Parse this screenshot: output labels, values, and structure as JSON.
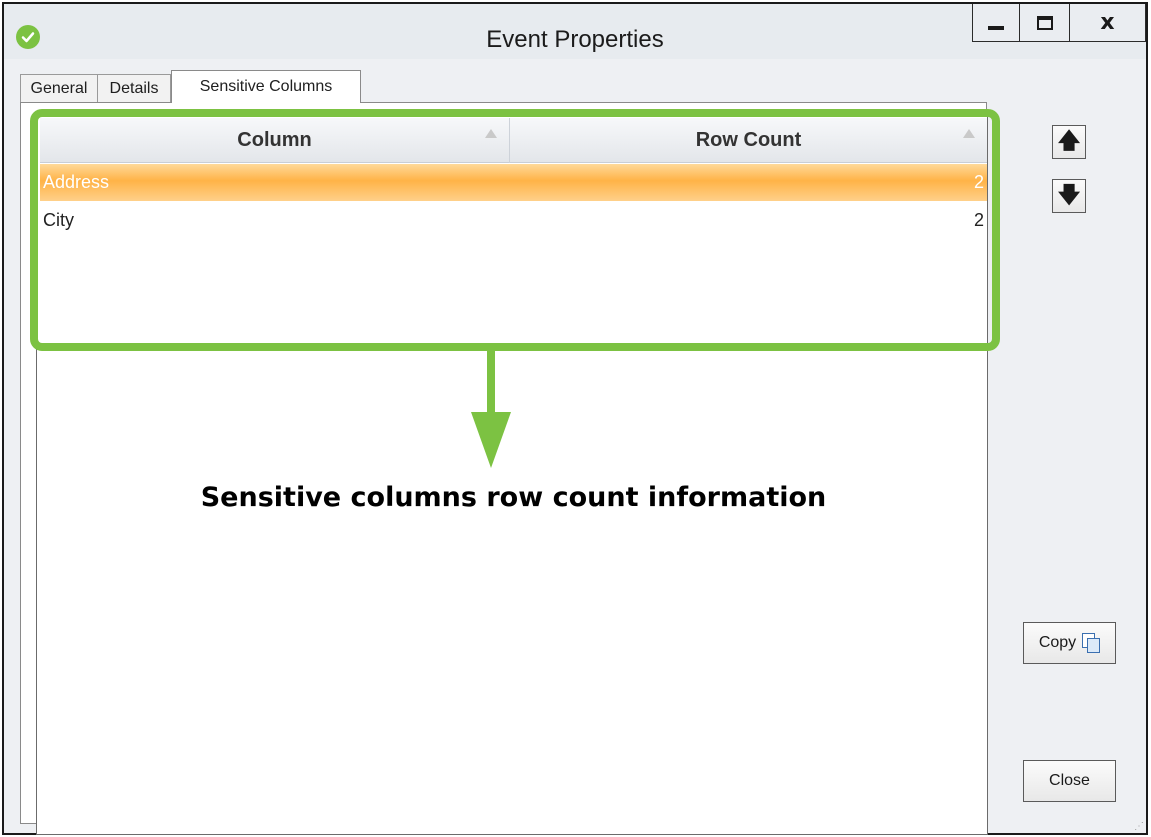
{
  "window": {
    "title": "Event Properties",
    "minimize_symbol": "",
    "maximize_symbol": "",
    "close_symbol": "x"
  },
  "tabs": [
    {
      "label": "General",
      "active": false
    },
    {
      "label": "Details",
      "active": false
    },
    {
      "label": "Sensitive Columns",
      "active": true
    }
  ],
  "grid": {
    "columns": [
      "Column",
      "Row Count"
    ],
    "rows": [
      {
        "column": "Address",
        "row_count": "2",
        "selected": true
      },
      {
        "column": "City",
        "row_count": "2",
        "selected": false
      }
    ]
  },
  "annotation": {
    "caption": "Sensitive columns row count information",
    "accent_color": "#7cc242"
  },
  "side_buttons": {
    "up_symbol": "🡅",
    "down_symbol": "🡇",
    "copy_label": "Copy",
    "close_label": "Close"
  },
  "colors": {
    "selection": "#ffb347",
    "accent": "#7cc242"
  }
}
